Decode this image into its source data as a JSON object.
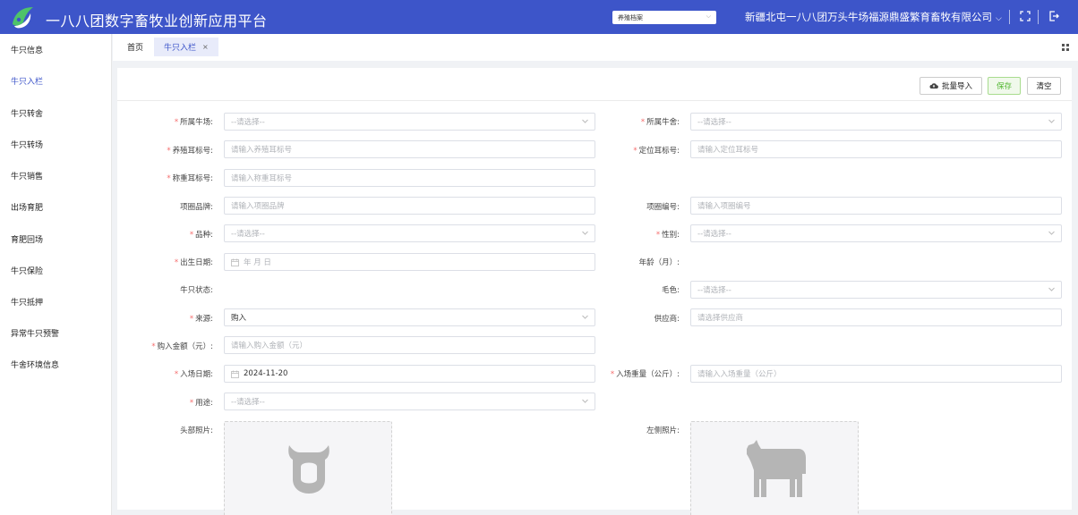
{
  "header": {
    "title": "一八八团数字畜牧业创新应用平台",
    "module_select": "养殖档案",
    "company": "新疆北屯一八八团万头牛场福源鼎盛繁育畜牧有限公司",
    "bg_color": "#3d55c9"
  },
  "sidebar": {
    "items": [
      {
        "label": "牛只信息"
      },
      {
        "label": "牛只入栏"
      },
      {
        "label": "牛只转舍"
      },
      {
        "label": "牛只转场"
      },
      {
        "label": "牛只销售"
      },
      {
        "label": "出场育肥"
      },
      {
        "label": "育肥回场"
      },
      {
        "label": "牛只保险"
      },
      {
        "label": "牛只抵押"
      },
      {
        "label": "异常牛只预警"
      },
      {
        "label": "牛舍环境信息"
      }
    ],
    "active": "牛只入栏"
  },
  "tabs": {
    "home": "首页",
    "active": "牛只入栏",
    "close": "×"
  },
  "toolbar": {
    "import": "批量导入",
    "save": "保存",
    "clear": "清空"
  },
  "form": {
    "farm": {
      "label": "所属牛场:",
      "placeholder": "--请选择--"
    },
    "barn": {
      "label": "所属牛舍:",
      "placeholder": "--请选择--"
    },
    "breed_tag": {
      "label": "养殖耳标号:",
      "placeholder": "请输入养殖耳标号"
    },
    "locate_tag": {
      "label": "定位耳标号:",
      "placeholder": "请输入定位耳标号"
    },
    "weigh_tag": {
      "label": "称重耳标号:",
      "placeholder": "请输入称重耳标号"
    },
    "collar_brand": {
      "label": "项圈品牌:",
      "placeholder": "请输入项圈品牌"
    },
    "collar_no": {
      "label": "项圈编号:",
      "placeholder": "请输入项圈编号"
    },
    "variety": {
      "label": "品种:",
      "placeholder": "--请选择--"
    },
    "gender": {
      "label": "性别:",
      "placeholder": "--请选择--"
    },
    "birth": {
      "label": "出生日期:",
      "placeholder": "年 月 日"
    },
    "age": {
      "label": "年龄（月）:"
    },
    "status": {
      "label": "牛只状态:"
    },
    "color": {
      "label": "毛色:",
      "placeholder": "--请选择--"
    },
    "source": {
      "label": "来源:",
      "value": "购入"
    },
    "supplier": {
      "label": "供应商:",
      "placeholder": "请选择供应商"
    },
    "price": {
      "label": "购入金额（元）:",
      "placeholder": "请输入购入金额（元）"
    },
    "entry_date": {
      "label": "入场日期:",
      "value": "2024-11-20"
    },
    "entry_weight": {
      "label": "入场重量（公斤）:",
      "placeholder": "请输入入场重量（公斤）"
    },
    "usage": {
      "label": "用途:",
      "placeholder": "--请选择--"
    },
    "head_photo": {
      "label": "头部照片:"
    },
    "side_photo": {
      "label": "左侧照片:"
    }
  },
  "colors": {
    "accent": "#3d55c9",
    "required": "#f56c6c",
    "save": "#56b936"
  }
}
